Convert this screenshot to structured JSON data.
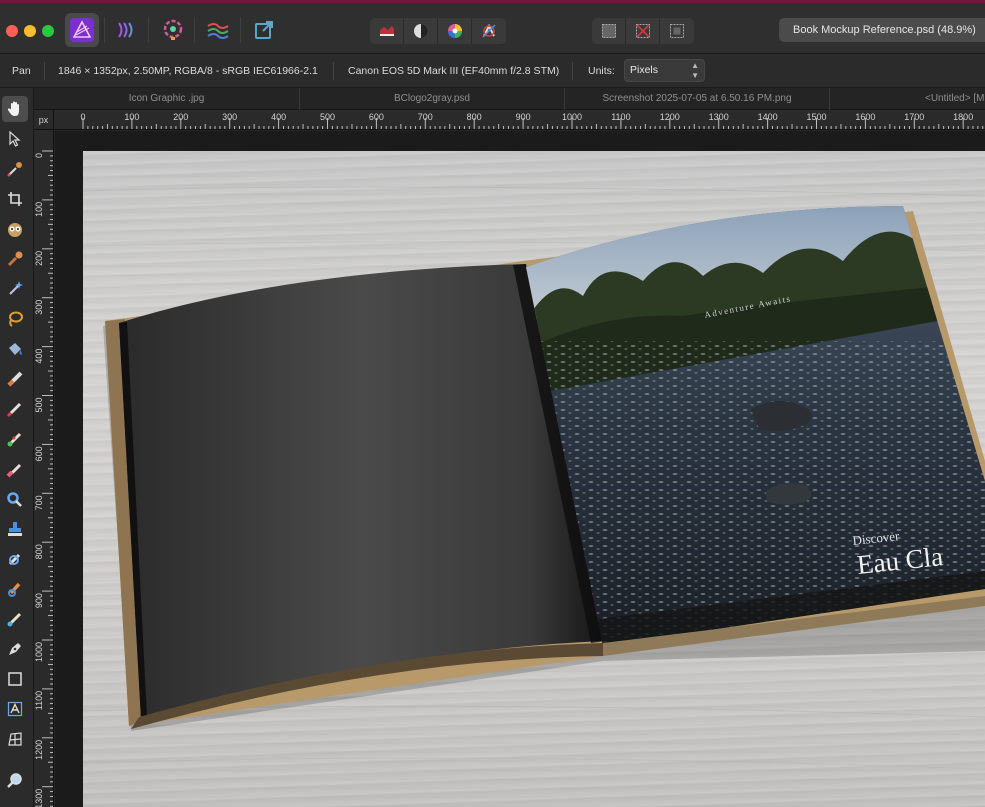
{
  "toolbar": {
    "document_name": "Book Mockup Reference.psd (48.9%)",
    "personas": [
      {
        "name": "photo-persona",
        "active": true
      },
      {
        "name": "liquify-persona",
        "active": false
      },
      {
        "name": "develop-persona",
        "active": false
      },
      {
        "name": "tone-mapping-persona",
        "active": false
      },
      {
        "name": "export-persona",
        "active": false
      }
    ],
    "accent_color": "#8b3fd8"
  },
  "context": {
    "tool_name": "Pan",
    "doc_info": "1846 × 1352px, 2.50MP, RGBA/8 - sRGB IEC61966-2.1",
    "camera_info": "Canon EOS 5D Mark III (EF40mm f/2.8 STM)",
    "units_label": "Units:",
    "units_value": "Pixels"
  },
  "tabs": [
    {
      "label": "Icon Graphic .jpg"
    },
    {
      "label": "BClogo2gray.psd"
    },
    {
      "label": "Screenshot 2025-07-05 at 6.50.16 PM.png"
    },
    {
      "label": "<Untitled> [M"
    }
  ],
  "ruler": {
    "unit_label": "px",
    "h_ticks": [
      "0",
      "100",
      "200",
      "300",
      "400",
      "500",
      "600",
      "700",
      "800",
      "900",
      "1000",
      "1100",
      "1200",
      "1300",
      "1400",
      "1500",
      "1600",
      "1700",
      "1800"
    ],
    "v_ticks": [
      "0",
      "100",
      "200",
      "300",
      "400",
      "500",
      "600",
      "700",
      "800",
      "900",
      "1000",
      "1100",
      "1200",
      "1300"
    ]
  },
  "artwork": {
    "page_text_small": "Adventure Awaits",
    "page_text_discover": "Discover",
    "page_text_title": "Eau Cla"
  }
}
